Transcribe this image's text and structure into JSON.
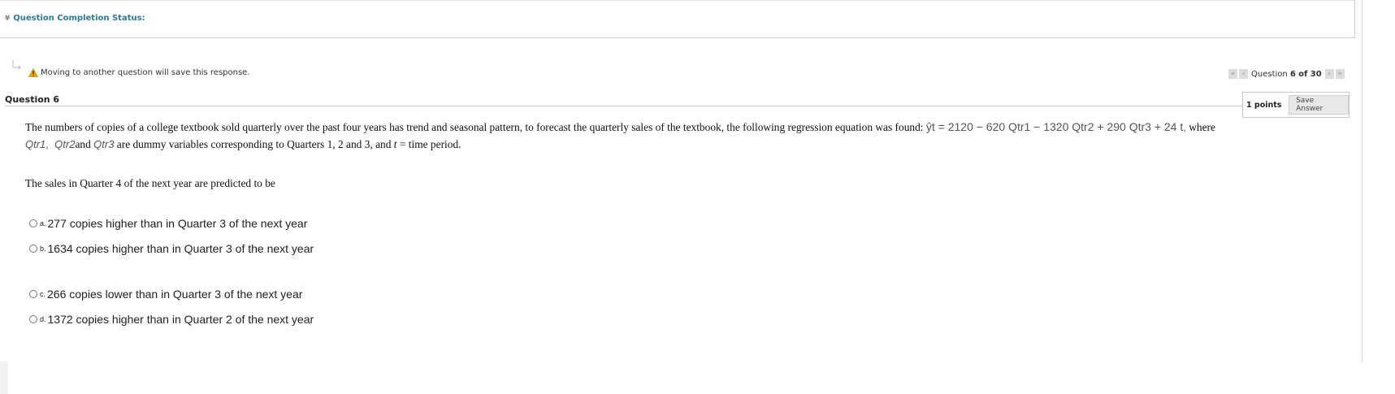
{
  "status": {
    "label": "Question Completion Status:",
    "chevron_icon": "chevron-down-icon"
  },
  "warning": {
    "text": "Moving to another question will save this response.",
    "icon": "warning-triangle-icon",
    "color": "#e8a000"
  },
  "pager": {
    "prefix": "Question",
    "current": "6",
    "of_text": "of 30",
    "icons": [
      "first-page-icon",
      "prev-page-icon",
      "next-page-icon",
      "last-page-icon"
    ]
  },
  "question": {
    "title": "Question 6",
    "points": "1 points",
    "save_label": "Save Answer",
    "text_before": "The numbers of copies of a college textbook sold quarterly over the past four years has trend and seasonal pattern, to forecast the quarterly sales of the textbook, the following regression equation was found: ",
    "equation": "ŷt = 2120 − 620 Qtr1 − 1320 Qtr2 + 290 Qtr3 + 24 t",
    "text_after_eq": " where",
    "dummy_1": "Qtr1",
    "dummy_2": "Qtr2",
    "and_word": "and",
    "dummy_3": "Qtr3",
    "text_line2": " are dummy variables corresponding to Quarters 1, 2 and 3, and",
    "t_var": "t",
    "text_line2_end": " = time period.",
    "prompt": "The sales in Quarter 4 of the next year are predicted to be"
  },
  "options": [
    {
      "letter": "a.",
      "text": "277 copies higher than in Quarter 3 of the next year"
    },
    {
      "letter": "b.",
      "text": "1634 copies higher than in Quarter 3 of the next year"
    },
    {
      "letter": "c.",
      "text": "266 copies lower than in Quarter 3 of the next year"
    },
    {
      "letter": "d.",
      "text": "1372 copies higher than in Quarter 2 of the next year"
    }
  ],
  "colors": {
    "accent": "#2a7a9c",
    "rule": "#cccccc"
  }
}
